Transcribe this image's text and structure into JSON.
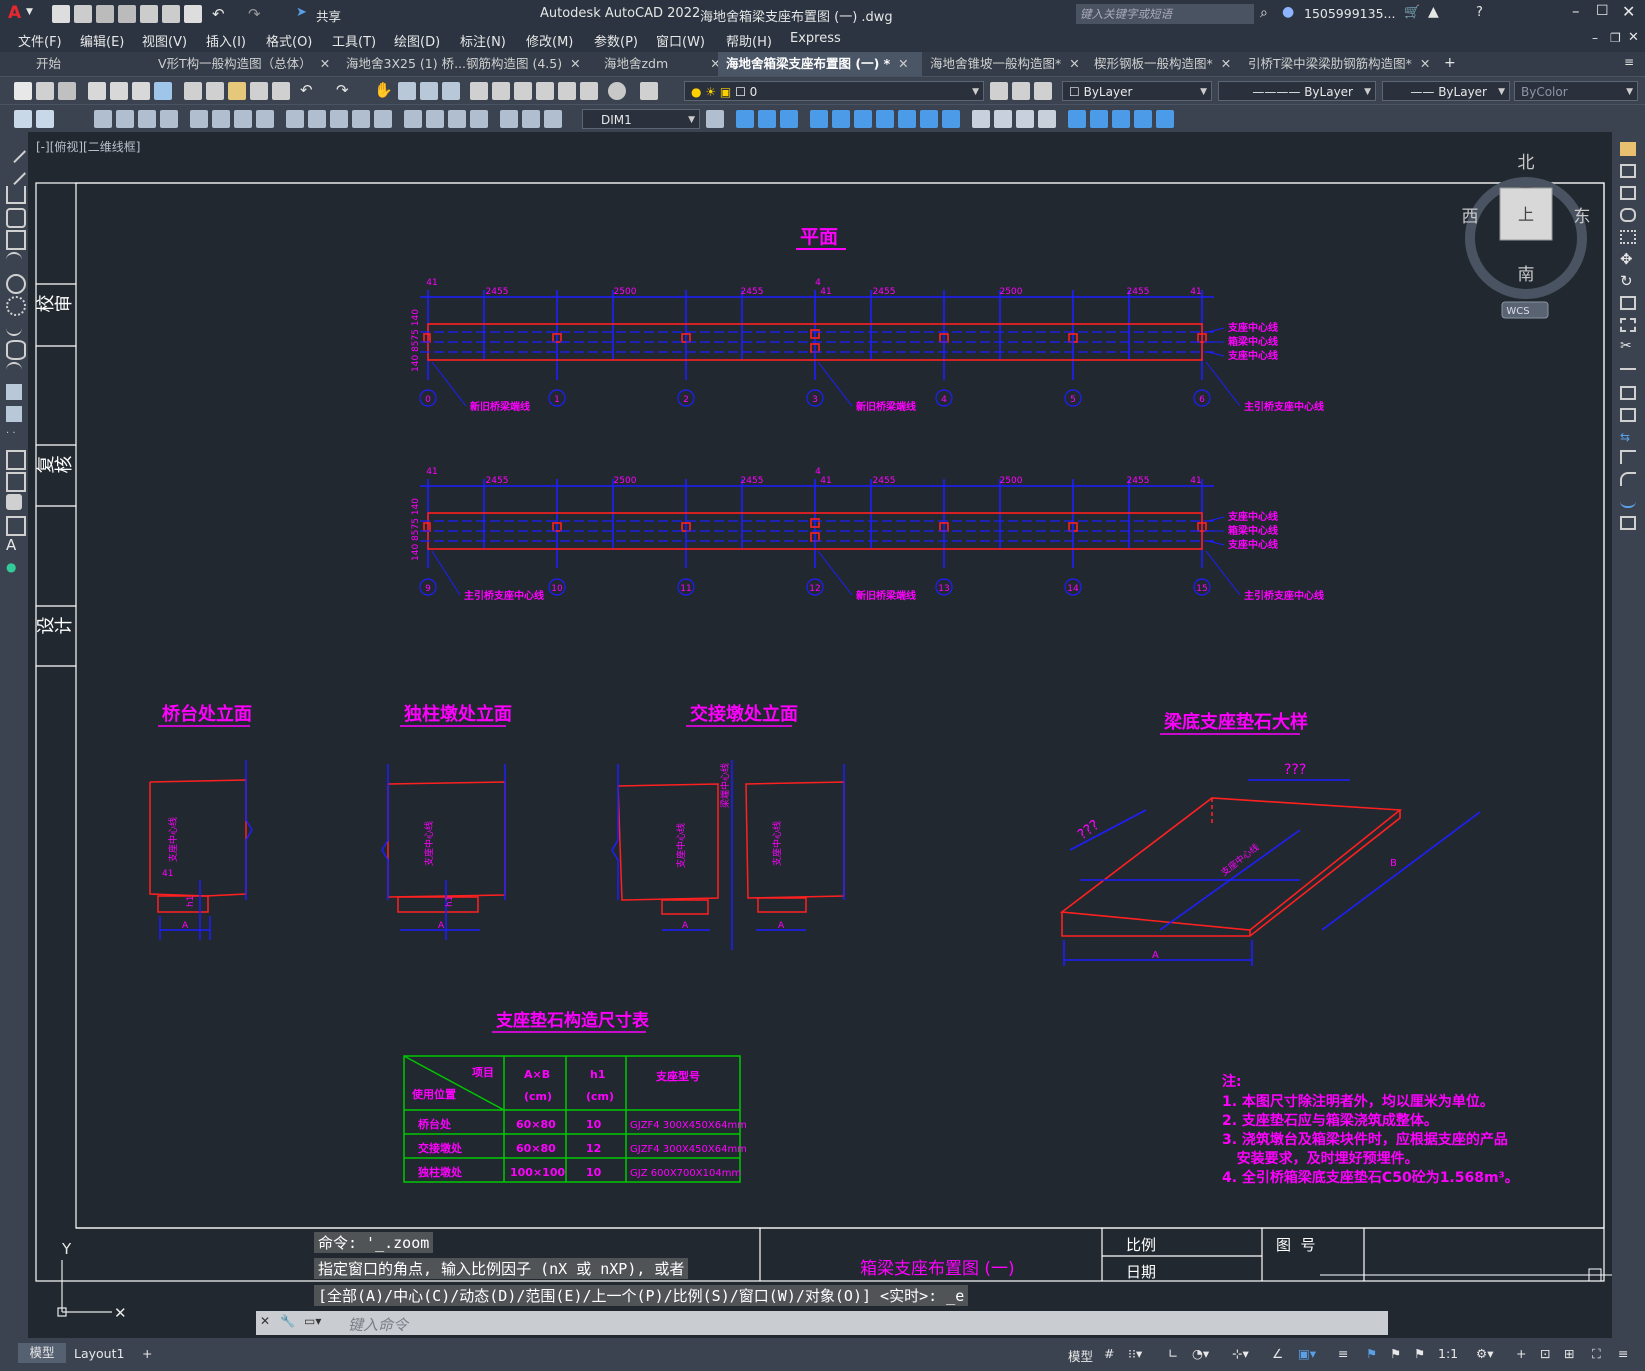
{
  "app": {
    "title": "Autodesk AutoCAD 2022",
    "document": "海地舍箱梁支座布置图 (一) .dwg",
    "share_label": "共享",
    "search_placeholder": "键入关键字或短语",
    "user": "1505999135...",
    "app_letter": "A"
  },
  "menu": [
    "文件(F)",
    "编辑(E)",
    "视图(V)",
    "插入(I)",
    "格式(O)",
    "工具(T)",
    "绘图(D)",
    "标注(N)",
    "修改(M)",
    "参数(P)",
    "窗口(W)",
    "帮助(H)",
    "Express"
  ],
  "tabs": [
    {
      "label": "开始"
    },
    {
      "label": "V形T构一般构造图（总体）"
    },
    {
      "label": "海地舍3X25 (1) 桥...钢筋构造图 (4.5)"
    },
    {
      "label": "海地舍zdm"
    },
    {
      "label": "海地舍箱梁支座布置图 (一) *"
    },
    {
      "label": "海地舍锥坡一般构造图*"
    },
    {
      "label": "楔形钢板一般构造图*"
    },
    {
      "label": "引桥T梁中梁梁肋钢筋构造图*"
    }
  ],
  "toolbar": {
    "layer": "0",
    "color": "ByLayer",
    "linetype": "ByLayer",
    "lineweight": "ByLayer",
    "plotstyle": "ByColor",
    "dimstyle": "DIM1"
  },
  "viewport_label": "[-][俯视][二维线框]",
  "viewcube": {
    "north": "北",
    "south": "南",
    "east": "东",
    "west": "西",
    "top": "上",
    "wcs": "WCS"
  },
  "drawing": {
    "side_labels": [
      "校审",
      "复核",
      "设计"
    ],
    "plan_title": "平面",
    "dims_top": [
      "41",
      "2455",
      "2500",
      "2455",
      "4",
      "41",
      "2455",
      "2500",
      "2455",
      "41"
    ],
    "plan1_axes": [
      "0",
      "1",
      "2",
      "3",
      "4",
      "5",
      "6"
    ],
    "plan2_axes": [
      "9",
      "10",
      "11",
      "12",
      "13",
      "14",
      "15"
    ],
    "plan1_notes": [
      "新旧桥梁端线",
      "新旧桥梁端线",
      "主引桥支座中心线"
    ],
    "plan2_notes": [
      "主引桥支座中心线",
      "新旧桥梁端线",
      "主引桥支座中心线"
    ],
    "right_labels": [
      "支座中心线",
      "箱梁中心线",
      "支座中心线"
    ],
    "left_dims": "140 8575 140",
    "elev_titles": [
      "桥台处立面",
      "独柱墩处立面",
      "交接墩处立面",
      "梁底支座垫石大样"
    ],
    "elev_labels": {
      "support_center": "支座中心线",
      "a": "A",
      "h1": "h1",
      "d41": "41",
      "beam_end": "梁端中心线"
    },
    "detail_dims": {
      "q1": "???",
      "q2": "???",
      "a": "A",
      "b": "B"
    },
    "table_title": "支座垫石构造尺寸表",
    "table": {
      "header": [
        "项目",
        "使用位置",
        "A×B",
        "(cm)",
        "h1",
        "(cm)",
        "支座型号"
      ],
      "rows": [
        [
          "桥台处",
          "60×80",
          "10",
          "GJZF4 300X450X64mm"
        ],
        [
          "交接墩处",
          "60×80",
          "12",
          "GJZF4 300X450X64mm"
        ],
        [
          "独柱墩处",
          "100×100",
          "10",
          "GJZ 600X700X104mm"
        ]
      ]
    },
    "notes_title": "注:",
    "notes": [
      "1. 本图尺寸除注明者外，均以厘米为单位。",
      "2. 支座垫石应与箱梁浇筑成整体。",
      "3. 浇筑墩台及箱梁块件时，应根据支座的产品",
      "   安装要求，及时埋好预埋件。",
      "4. 全引桥箱梁底支座垫石C50砼为1.568m³。"
    ],
    "title_block": {
      "scale": "比例",
      "date": "日期",
      "drawing_no": "图  号",
      "name": "箱梁支座布置图 (一)"
    }
  },
  "command": {
    "line1": "命令: '_.zoom",
    "line2": "指定窗口的角点, 输入比例因子 (nX 或 nXP), 或者",
    "line3": "[全部(A)/中心(C)/动态(D)/范围(E)/上一个(P)/比例(S)/窗口(W)/对象(O)] <实时>: _e",
    "placeholder": "键入命令"
  },
  "layout_tabs": [
    "模型",
    "Layout1",
    "+"
  ],
  "status": {
    "model": "模型",
    "scale": "1:1"
  },
  "colors": {
    "bg": "#212830",
    "magenta": "#ff00ff",
    "blue": "#1e1eff",
    "red": "#ff2020",
    "green": "#00c800",
    "white": "#ffffff"
  }
}
